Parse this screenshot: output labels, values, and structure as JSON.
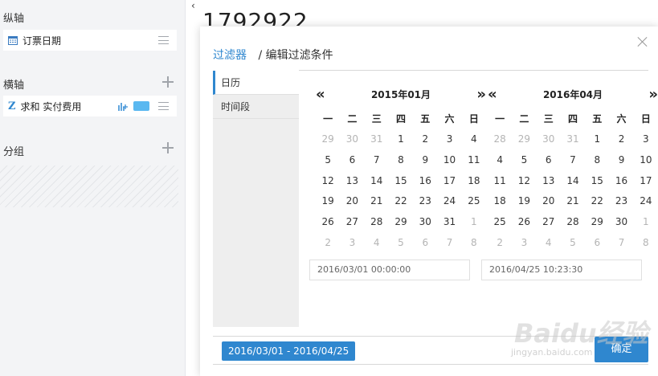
{
  "left": {
    "y_axis": {
      "title": "纵轴",
      "field_label": "订票日期"
    },
    "x_axis": {
      "title": "横轴",
      "field_prefix": "Z",
      "field_label": "求和 实付费用"
    },
    "group": {
      "title": "分组"
    },
    "icons": [
      "calendar-icon",
      "chart-icon",
      "menu-icon",
      "plus-icon"
    ]
  },
  "header": {
    "number": "1792922"
  },
  "dialog": {
    "breadcrumb_link": "过滤器",
    "breadcrumb_separator": "/",
    "breadcrumb_current": "编辑过滤条件",
    "tabs": [
      "日历",
      "时间段"
    ],
    "active_tab": "日历",
    "prev_label": "«",
    "next_label": "»",
    "weekdays": [
      "一",
      "二",
      "三",
      "四",
      "五",
      "六",
      "日"
    ],
    "calendars": [
      {
        "month": "2015年01月",
        "days": [
          {
            "d": "29",
            "dim": true
          },
          {
            "d": "30",
            "dim": true
          },
          {
            "d": "31",
            "dim": true
          },
          {
            "d": "1"
          },
          {
            "d": "2"
          },
          {
            "d": "3"
          },
          {
            "d": "4"
          },
          {
            "d": "5"
          },
          {
            "d": "6"
          },
          {
            "d": "7"
          },
          {
            "d": "8"
          },
          {
            "d": "9"
          },
          {
            "d": "10"
          },
          {
            "d": "11"
          },
          {
            "d": "12"
          },
          {
            "d": "13"
          },
          {
            "d": "14"
          },
          {
            "d": "15"
          },
          {
            "d": "16"
          },
          {
            "d": "17"
          },
          {
            "d": "18"
          },
          {
            "d": "19"
          },
          {
            "d": "20"
          },
          {
            "d": "21"
          },
          {
            "d": "22"
          },
          {
            "d": "23"
          },
          {
            "d": "24"
          },
          {
            "d": "25"
          },
          {
            "d": "26"
          },
          {
            "d": "27"
          },
          {
            "d": "28"
          },
          {
            "d": "29"
          },
          {
            "d": "30"
          },
          {
            "d": "31"
          },
          {
            "d": "1",
            "dim": true
          },
          {
            "d": "2",
            "dim": true
          },
          {
            "d": "3",
            "dim": true
          },
          {
            "d": "4",
            "dim": true
          },
          {
            "d": "5",
            "dim": true
          },
          {
            "d": "6",
            "dim": true
          },
          {
            "d": "7",
            "dim": true
          },
          {
            "d": "8",
            "dim": true
          }
        ],
        "input": "2016/03/01 00:00:00"
      },
      {
        "month": "2016年04月",
        "days": [
          {
            "d": "28",
            "dim": true
          },
          {
            "d": "29",
            "dim": true
          },
          {
            "d": "30",
            "dim": true
          },
          {
            "d": "31",
            "dim": true
          },
          {
            "d": "1"
          },
          {
            "d": "2"
          },
          {
            "d": "3"
          },
          {
            "d": "4"
          },
          {
            "d": "5"
          },
          {
            "d": "6"
          },
          {
            "d": "7"
          },
          {
            "d": "8"
          },
          {
            "d": "9"
          },
          {
            "d": "10"
          },
          {
            "d": "11"
          },
          {
            "d": "12"
          },
          {
            "d": "13"
          },
          {
            "d": "14"
          },
          {
            "d": "15"
          },
          {
            "d": "16"
          },
          {
            "d": "17"
          },
          {
            "d": "18"
          },
          {
            "d": "19"
          },
          {
            "d": "20"
          },
          {
            "d": "21"
          },
          {
            "d": "22"
          },
          {
            "d": "23"
          },
          {
            "d": "24"
          },
          {
            "d": "25"
          },
          {
            "d": "26"
          },
          {
            "d": "27"
          },
          {
            "d": "28"
          },
          {
            "d": "29"
          },
          {
            "d": "30"
          },
          {
            "d": "1",
            "dim": true
          },
          {
            "d": "2",
            "dim": true
          },
          {
            "d": "3",
            "dim": true
          },
          {
            "d": "4",
            "dim": true
          },
          {
            "d": "5",
            "dim": true
          },
          {
            "d": "6",
            "dim": true
          },
          {
            "d": "7",
            "dim": true
          },
          {
            "d": "8",
            "dim": true
          }
        ],
        "input": "2016/04/25 10:23:30"
      }
    ],
    "range_label": "2016/03/01 - 2016/04/25",
    "confirm_label": "确定"
  },
  "watermark": {
    "text": "Baidu经验",
    "url_text": "jingyan.baidu.com"
  },
  "colors": {
    "accent": "#2f87cf",
    "sidebar_bg": "#f3f4f6",
    "tag_blue": "#5ab8f0"
  }
}
